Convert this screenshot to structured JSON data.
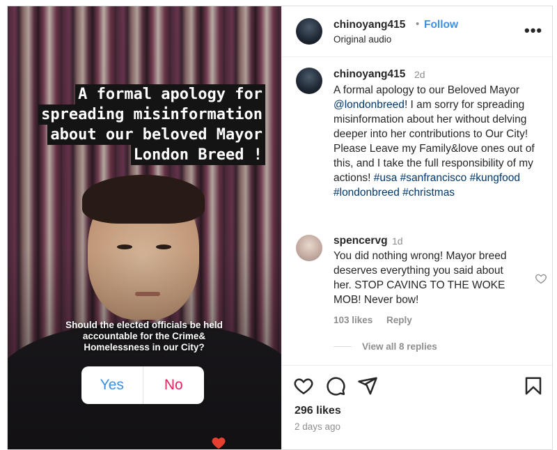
{
  "video": {
    "overlay_lines": [
      "A formal apology for",
      "spreading misinformation",
      "about our beloved Mayor",
      "London Breed !"
    ],
    "poll": {
      "question": "Should the elected officials be held accountable for the Crime& Homelessness in our City?",
      "options": [
        "Yes",
        "No"
      ]
    }
  },
  "header": {
    "username": "chinoyang415",
    "separator": "•",
    "follow_label": "Follow",
    "subtitle": "Original audio",
    "more_icon": "more-horizontal-icon"
  },
  "caption": {
    "username": "chinoyang415",
    "time": "2d",
    "text_before": "A formal apology to our Beloved Mayor ",
    "mention": "@londonbreed",
    "text_after": "! I am sorry for spreading misinformation about her without delving deeper into her contributions to Our City! Please Leave my Family&love ones out of this, and I take the full responsibility of my actions! ",
    "hashtags": [
      "#usa",
      "#sanfrancisco",
      "#kungfood",
      "#londonbreed",
      "#christmas"
    ]
  },
  "comment": {
    "username": "spencervg",
    "time": "1d",
    "text": "You did nothing wrong! Mayor breed deserves everything you said about her. STOP CAVING TO THE WOKE MOB! Never bow!",
    "likes": "103 likes",
    "reply_label": "Reply",
    "view_replies": "View all 8 replies"
  },
  "actions": {
    "icons": [
      "heart-icon",
      "comment-icon",
      "share-icon",
      "bookmark-icon"
    ]
  },
  "stats": {
    "likes": "296 likes",
    "posted": "2 days ago"
  },
  "colors": {
    "link": "#00376b",
    "follow": "#3e8fe6",
    "secondary_text": "#8e8e8e",
    "poll_yes": "#3a8ee6",
    "poll_no": "#e0245e"
  }
}
